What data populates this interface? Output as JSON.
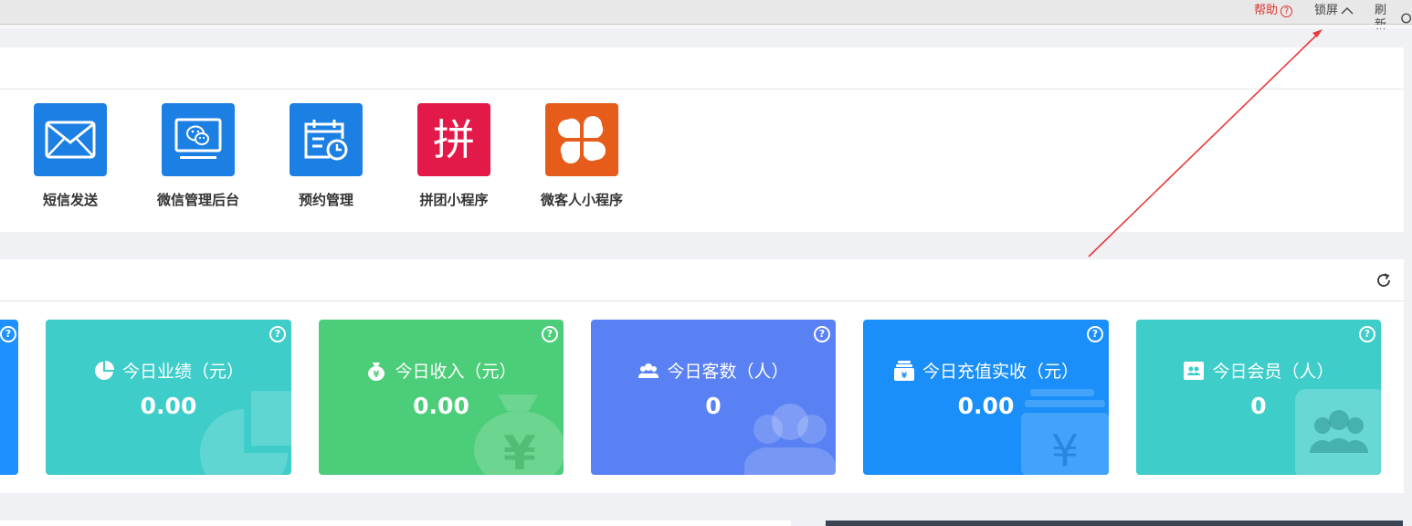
{
  "topbar": {
    "help_label": "帮助",
    "help_icon": "?",
    "lock_label": "锁屏",
    "refresh_label": "刷新"
  },
  "apps": [
    {
      "label": "短信发送",
      "icon": "envelope-icon",
      "color": "#1b7fe3"
    },
    {
      "label": "微信管理后台",
      "icon": "wechat-monitor-icon",
      "color": "#1b7fe3"
    },
    {
      "label": "预约管理",
      "icon": "calendar-clock-icon",
      "color": "#1b7fe3"
    },
    {
      "label": "拼团小程序",
      "icon_text": "拼",
      "color": "#e3194a"
    },
    {
      "label": "微客人小程序",
      "icon": "four-petal-icon",
      "color": "#e65c1b"
    }
  ],
  "stats": {
    "cards": [
      {
        "title": "今日业绩（元）",
        "value": "0.00",
        "icon": "pie-chart-icon",
        "color": "#3ecdc9"
      },
      {
        "title": "今日收入（元）",
        "value": "0.00",
        "icon": "money-bag-icon",
        "color": "#4ccd79"
      },
      {
        "title": "今日客数（人）",
        "value": "0",
        "icon": "people-icon",
        "color": "#5a81f3"
      },
      {
        "title": "今日充值实收（元）",
        "value": "0.00",
        "icon": "recharge-icon",
        "color": "#1a8ff9"
      },
      {
        "title": "今日会员（人）",
        "value": "0",
        "icon": "member-card-icon",
        "color": "#3ecdc9"
      }
    ]
  }
}
